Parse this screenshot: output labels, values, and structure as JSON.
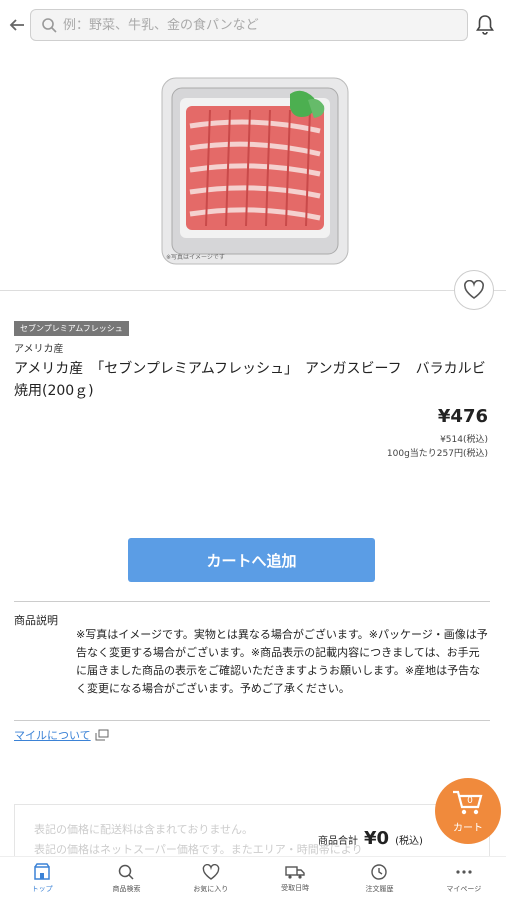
{
  "search": {
    "placeholder": "例：野菜、牛乳、金の食パンなど"
  },
  "product": {
    "brand_badge": "セブンプレミアムフレッシュ",
    "origin": "アメリカ産",
    "title": "アメリカ産　「セブンプレミアムフレッシュ」　アンガスビーフ　バラカルビ焼用(200ｇ)",
    "photo_note": "※写真はイメージです",
    "price": "¥476",
    "tax_price": "¥514(税込)",
    "unit_price": "100g当たり257円(税込)"
  },
  "actions": {
    "add_to_cart": "カートへ追加"
  },
  "description": {
    "heading": "商品説明",
    "text": "※写真はイメージです。実物とは異なる場合がございます。※パッケージ・画像は予告なく変更する場合がございます。※商品表示の記載内容につきましては、お手元に届きました商品の表示をご確認いただきますようお願いします。※産地は予告なく変更になる場合がございます。予めご了承ください。"
  },
  "mile_link": "マイルについて",
  "summary": {
    "note1": "表記の価格に配送料は含まれておりません。",
    "note2": "表記の価格はネットスーパー価格です。またエリア・時間帯により",
    "total_label": "商品合計",
    "total_value": "¥0",
    "total_tax": "(税込)"
  },
  "cart_fab": {
    "count": "0",
    "label": "カート"
  },
  "nav": [
    {
      "label": "トップ",
      "icon": "store-icon"
    },
    {
      "label": "商品検索",
      "icon": "search-icon"
    },
    {
      "label": "お気に入り",
      "icon": "heart-icon"
    },
    {
      "label": "受取日時",
      "icon": "truck-icon"
    },
    {
      "label": "注文履歴",
      "icon": "history-icon"
    },
    {
      "label": "マイページ",
      "icon": "more-icon"
    }
  ],
  "colors": {
    "accent": "#5b9de5",
    "cart": "#f08a3c",
    "link": "#3b82d6"
  }
}
